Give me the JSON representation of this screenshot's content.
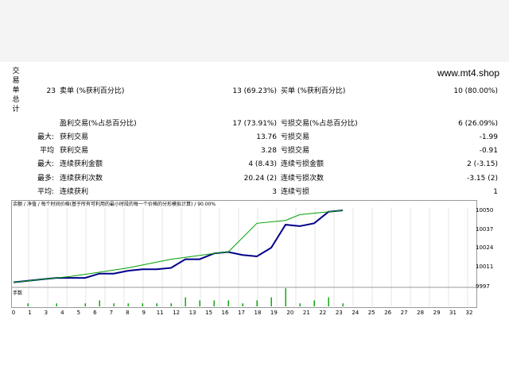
{
  "site": "www.mt4.shop",
  "side_label": [
    "交",
    "易",
    "单",
    "总",
    "计"
  ],
  "stats": {
    "total_trades": "23",
    "short_label": "卖单 (%获利百分比)",
    "short_value": "13 (69.23%)",
    "long_label": "买单 (%获利百分比)",
    "long_value": "10 (80.00%)",
    "profit_trades_label": "盈利交易(%占总百分比)",
    "profit_trades_value": "17 (73.91%)",
    "loss_trades_label": "亏损交易(%占总百分比)",
    "loss_trades_value": "6 (26.09%)",
    "rows": [
      {
        "prefix": "最大:",
        "l1": "获利交易",
        "v1": "13.76",
        "l2": "亏损交易",
        "v2": "-1.99"
      },
      {
        "prefix": "平均",
        "l1": "获利交易",
        "v1": "3.28",
        "l2": "亏损交易",
        "v2": "-0.91"
      },
      {
        "prefix": "最大:",
        "l1": "连续获利金额",
        "v1": "4 (8.43)",
        "l2": "连续亏损金额",
        "v2": "2 (-3.15)"
      },
      {
        "prefix": "最多:",
        "l1": "连续获利次数",
        "v1": "20.24 (2)",
        "l2": "连续亏损次数",
        "v2": "-3.15 (2)"
      },
      {
        "prefix": "平均:",
        "l1": "连续获利",
        "v1": "3",
        "l2": "连续亏损",
        "v2": "1"
      }
    ]
  },
  "chart": {
    "legend": "余额 / 净值 / 每个时间价格(基于所有可利用的最小时段的每一个价格的分形模拟计算) / 90.00%",
    "volume_label": "手数",
    "colors": {
      "balance": "#00008b",
      "equity": "#00a000",
      "volume": "#00a000"
    }
  },
  "chart_data": {
    "type": "line",
    "x_ticks": [
      "0",
      "1",
      "3",
      "4",
      "5",
      "6",
      "7",
      "8",
      "9",
      "11",
      "12",
      "13",
      "15",
      "16",
      "17",
      "18",
      "19",
      "20",
      "21",
      "22",
      "23",
      "24",
      "25",
      "26",
      "27",
      "28",
      "29",
      "31",
      "32"
    ],
    "y_ticks": [
      "10050",
      "10037",
      "10024",
      "10011",
      "9997"
    ],
    "ylim": [
      9997,
      10053
    ],
    "series": [
      {
        "x": [
          0,
          1,
          2,
          3,
          4,
          5,
          6,
          7,
          8,
          9,
          10,
          11,
          12,
          13,
          14,
          15,
          16,
          17,
          18,
          19,
          20,
          21,
          22,
          23
        ],
        "y": [
          10000,
          10001,
          10002,
          10003,
          10003,
          10003,
          10006,
          10006,
          10008,
          10009,
          10009,
          10010,
          10016,
          10016,
          10020,
          10021,
          10019,
          10018,
          10024,
          10040,
          10039,
          10041,
          10049,
          10050
        ]
      },
      {
        "x": [
          0,
          4,
          8,
          11,
          14,
          15,
          17,
          19,
          20,
          21,
          23
        ],
        "y": [
          10000,
          10004,
          10010,
          10016,
          10020,
          10021,
          10041,
          10043,
          10047,
          10048,
          10050
        ]
      }
    ],
    "volume": {
      "x": [
        1,
        3,
        5,
        6,
        7,
        8,
        9,
        10,
        11,
        12,
        13,
        14,
        15,
        16,
        17,
        18,
        19,
        20,
        21,
        22,
        23
      ],
      "y": [
        1,
        1,
        1,
        2,
        1,
        1,
        1,
        1,
        1,
        3,
        2,
        2,
        2,
        1,
        2,
        3,
        6,
        1,
        2,
        3,
        1
      ]
    }
  }
}
